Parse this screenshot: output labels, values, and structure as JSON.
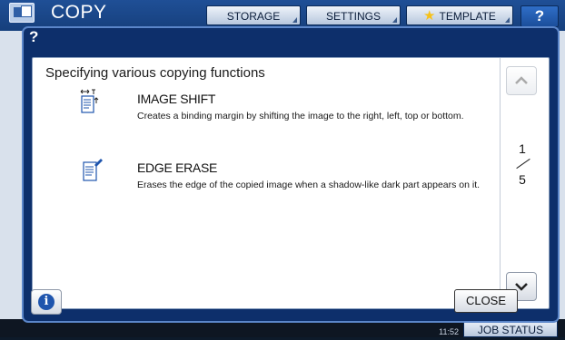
{
  "app": {
    "title": "COPY",
    "icon": "copy-icon"
  },
  "toolbar": {
    "storage_label": "STORAGE",
    "settings_label": "SETTINGS",
    "template_label": "TEMPLATE",
    "help_label": "?"
  },
  "dialog": {
    "title": "?",
    "heading": "Specifying various copying functions",
    "items": [
      {
        "title": "IMAGE SHIFT",
        "description": "Creates a binding margin by shifting the image to the right, left, top or bottom.",
        "icon": "image-shift-icon"
      },
      {
        "title": "EDGE ERASE",
        "description": "Erases the edge of the copied image when a shadow-like dark part appears on it.",
        "icon": "edge-erase-icon"
      }
    ],
    "page": {
      "current": "1",
      "total": "5"
    },
    "close_label": "CLOSE",
    "info_icon": "info-icon"
  },
  "status": {
    "time": "11:52",
    "job_status_label": "JOB STATUS"
  },
  "colors": {
    "title_bar": "#1f4f96",
    "dialog_frame": "#0d2f6b",
    "accent_icon": "#1f55ad",
    "star": "#f6c11a"
  }
}
